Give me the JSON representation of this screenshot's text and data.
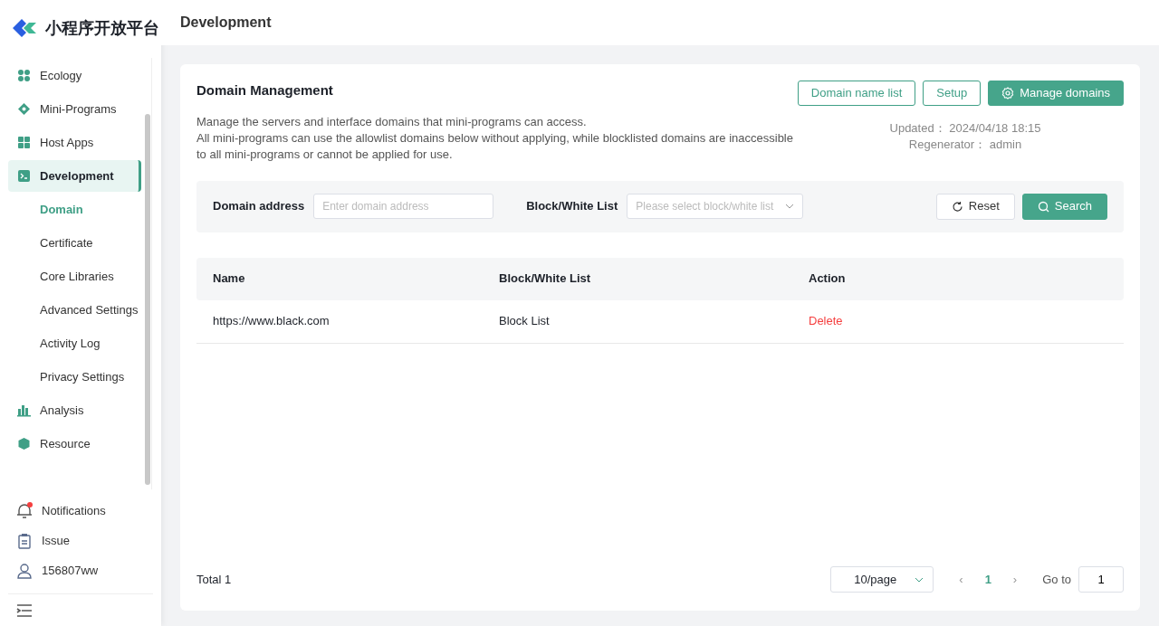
{
  "brand": {
    "title": "小程序开放平台"
  },
  "sidebar": {
    "items": [
      {
        "label": "Ecology",
        "selected": false
      },
      {
        "label": "Mini-Programs",
        "selected": false
      },
      {
        "label": "Host Apps",
        "selected": false
      },
      {
        "label": "Development",
        "selected": true,
        "children": [
          {
            "label": "Domain",
            "selected": true
          },
          {
            "label": "Certificate",
            "selected": false
          },
          {
            "label": "Core Libraries",
            "selected": false
          },
          {
            "label": "Advanced Settings",
            "selected": false
          },
          {
            "label": "Activity Log",
            "selected": false
          },
          {
            "label": "Privacy Settings",
            "selected": false
          }
        ]
      },
      {
        "label": "Analysis",
        "selected": false
      },
      {
        "label": "Resource",
        "selected": false
      }
    ],
    "footer": [
      {
        "label": "Notifications",
        "unread": true
      },
      {
        "label": "Issue",
        "unread": false
      },
      {
        "label": "156807ww",
        "unread": false
      }
    ]
  },
  "header": {
    "title": "Development"
  },
  "card": {
    "title": "Domain Management",
    "description": [
      "Manage the servers and interface domains that mini-programs can access.",
      "All mini-programs can use the allowlist domains below without applying, while blocklisted domains are inaccessible to all mini-programs or cannot be applied for use."
    ],
    "actions": [
      {
        "label": "Domain name list",
        "kind": "outline"
      },
      {
        "label": "Setup",
        "kind": "outline"
      },
      {
        "label": "Manage domains",
        "kind": "primary"
      }
    ],
    "meta": [
      {
        "label": "Updated：",
        "value": "2024/04/18 18:15"
      },
      {
        "label": "Regenerator：",
        "value": "admin"
      }
    ]
  },
  "filters": {
    "domain": {
      "label": "Domain address",
      "placeholder": "Enter domain address"
    },
    "list": {
      "label": "Block/White List",
      "placeholder": "Please select block/white list"
    },
    "buttons": [
      {
        "label": "Reset",
        "kind": "default"
      },
      {
        "label": "Search",
        "kind": "primary"
      }
    ]
  },
  "table": {
    "columns": [
      "Name",
      "Block/White List",
      "Action"
    ],
    "rows": [
      {
        "name": "https://www.black.com",
        "list": "Block List",
        "action": "Delete"
      }
    ]
  },
  "pagination": {
    "total": "Total 1",
    "page_size": "10/page",
    "prev": "‹",
    "pages": [
      {
        "label": "1",
        "selected": true
      }
    ],
    "next": "›",
    "goto_label": "Go to",
    "goto_value": "1"
  }
}
